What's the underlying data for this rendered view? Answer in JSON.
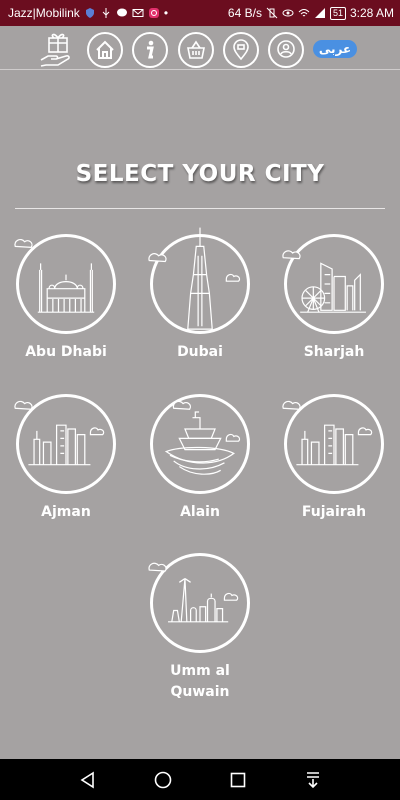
{
  "status_bar": {
    "carrier": "Jazz|Mobilink",
    "speed": "64 B/s",
    "battery": "51",
    "time": "3:28 AM"
  },
  "nav": {
    "language_button": "عربى",
    "icons": [
      "gift-hand-icon",
      "home-icon",
      "info-icon",
      "basket-icon",
      "location-icon",
      "chat-icon"
    ]
  },
  "page": {
    "title": "SELECT YOUR CITY"
  },
  "cities": [
    {
      "name": "Abu Dhabi",
      "icon": "mosque-icon"
    },
    {
      "name": "Dubai",
      "icon": "burj-khalifa-icon"
    },
    {
      "name": "Sharjah",
      "icon": "sharjah-skyline-icon"
    },
    {
      "name": "Ajman",
      "icon": "ajman-skyline-icon"
    },
    {
      "name": "Alain",
      "icon": "ship-icon"
    },
    {
      "name": "Fujairah",
      "icon": "fujairah-skyline-icon"
    },
    {
      "name": "Umm al Quwain",
      "icon": "umm-al-quwain-skyline-icon",
      "name_lines": [
        "Umm al",
        "Quwain"
      ]
    }
  ],
  "system_nav": {
    "icons": [
      "back-icon",
      "home-circle-icon",
      "recents-icon",
      "notification-pull-icon"
    ]
  },
  "colors": {
    "background": "#a5a2a2",
    "status_bar": "#6b0d1f",
    "accent": "#4a90e2"
  }
}
